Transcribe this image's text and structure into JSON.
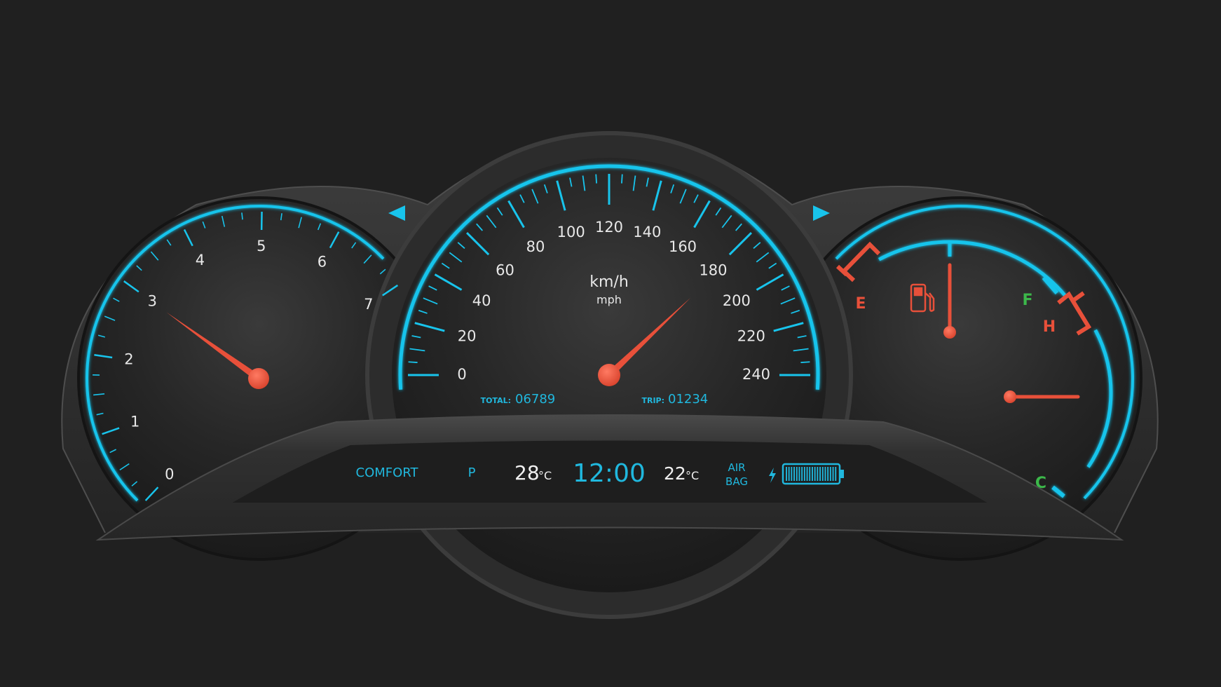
{
  "colors": {
    "accent": "#18c4ec",
    "needle": "#e8503a",
    "warning": "#e8503a",
    "ok": "#3cb84a",
    "text": "#e8e8e8",
    "display_text": "#20b8de"
  },
  "tachometer": {
    "labels": [
      "0",
      "1",
      "2",
      "3",
      "4",
      "5",
      "6",
      "7"
    ],
    "value": 3
  },
  "speedometer": {
    "unit_primary": "km/h",
    "unit_secondary": "mph",
    "labels": [
      "0",
      "20",
      "40",
      "60",
      "80",
      "100",
      "120",
      "140",
      "160",
      "180",
      "200",
      "220",
      "240"
    ],
    "value": 182,
    "odometer": {
      "total_label": "TOTAL:",
      "total_value": "06789",
      "trip_label": "TRIP:",
      "trip_value": "01234"
    }
  },
  "fuel_gauge": {
    "empty_label": "E",
    "full_label": "F",
    "level": 0.5,
    "icon": "fuel-pump-icon"
  },
  "temp_gauge": {
    "hot_label": "H",
    "cold_label": "C",
    "level": 0.5
  },
  "indicators": {
    "left_turn": "turn-left-icon",
    "right_turn": "turn-right-icon"
  },
  "display": {
    "mode": "COMFORT",
    "gear": "P",
    "outside_temp": "28",
    "outside_temp_unit": "°C",
    "time": "12:00",
    "inside_temp": "22",
    "inside_temp_unit": "°C",
    "airbag_line1": "AIR",
    "airbag_line2": "BAG",
    "battery_icon": "battery-icon",
    "charge_icon": "bolt-icon",
    "battery_level": 1.0
  }
}
